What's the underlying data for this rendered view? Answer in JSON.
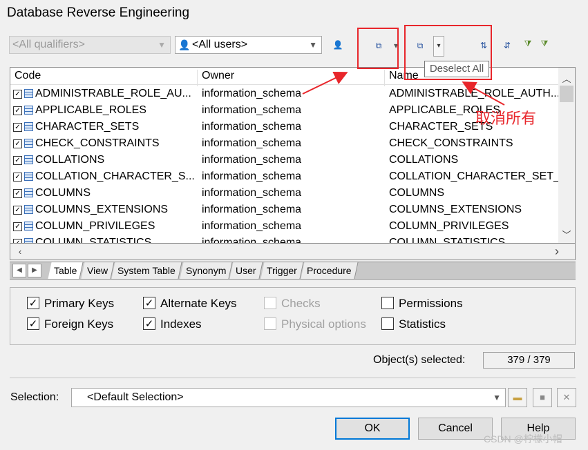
{
  "window": {
    "title": "Database Reverse Engineering"
  },
  "filters": {
    "qualifier": "<All qualifiers>",
    "users": "<All users>"
  },
  "toolbar": {
    "tooltip": "Deselect All"
  },
  "grid": {
    "columns": [
      "Code",
      "Owner",
      "Name"
    ],
    "rows": [
      {
        "code": "ADMINISTRABLE_ROLE_AU...",
        "owner": "information_schema",
        "name": "ADMINISTRABLE_ROLE_AUTH..."
      },
      {
        "code": "APPLICABLE_ROLES",
        "owner": "information_schema",
        "name": "APPLICABLE_ROLES"
      },
      {
        "code": "CHARACTER_SETS",
        "owner": "information_schema",
        "name": "CHARACTER_SETS"
      },
      {
        "code": "CHECK_CONSTRAINTS",
        "owner": "information_schema",
        "name": "CHECK_CONSTRAINTS"
      },
      {
        "code": "COLLATIONS",
        "owner": "information_schema",
        "name": "COLLATIONS"
      },
      {
        "code": "COLLATION_CHARACTER_S...",
        "owner": "information_schema",
        "name": "COLLATION_CHARACTER_SET_"
      },
      {
        "code": "COLUMNS",
        "owner": "information_schema",
        "name": "COLUMNS"
      },
      {
        "code": "COLUMNS_EXTENSIONS",
        "owner": "information_schema",
        "name": "COLUMNS_EXTENSIONS"
      },
      {
        "code": "COLUMN_PRIVILEGES",
        "owner": "information_schema",
        "name": "COLUMN_PRIVILEGES"
      },
      {
        "code": "COLUMN_STATISTICS",
        "owner": "information_schema",
        "name": "COLUMN_STATISTICS"
      }
    ]
  },
  "tabs": [
    "Table",
    "View",
    "System Table",
    "Synonym",
    "User",
    "Trigger",
    "Procedure"
  ],
  "options": {
    "primary_keys": "Primary Keys",
    "foreign_keys": "Foreign Keys",
    "alternate_keys": "Alternate Keys",
    "indexes": "Indexes",
    "checks": "Checks",
    "physical_options": "Physical options",
    "permissions": "Permissions",
    "statistics": "Statistics"
  },
  "status": {
    "label": "Object(s) selected:",
    "value": "379 / 379"
  },
  "selection": {
    "label": "Selection:",
    "value": "<Default Selection>"
  },
  "buttons": {
    "ok": "OK",
    "cancel": "Cancel",
    "help": "Help"
  },
  "annotation": {
    "text": "取消所有"
  },
  "watermark": "CSDN @柠檬小帽",
  "colors": {
    "annotation": "#e8262b",
    "default_button_border": "#0078d7"
  }
}
